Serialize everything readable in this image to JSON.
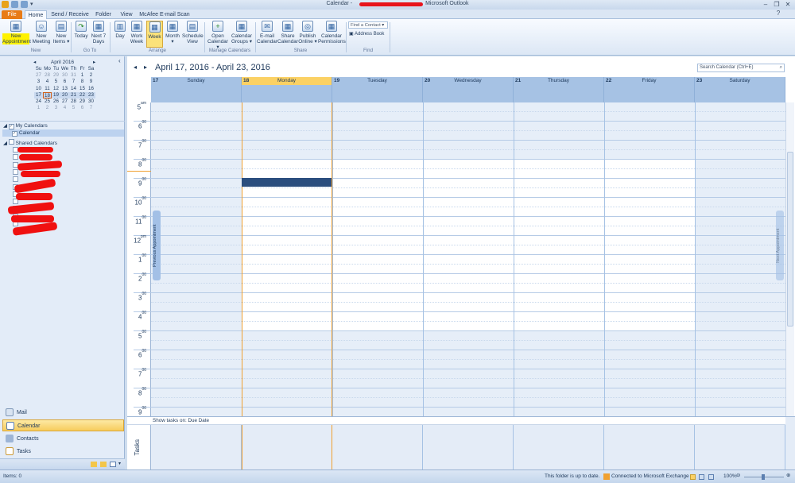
{
  "window": {
    "title_left": "Calendar - ",
    "title_right": "Microsoft Outlook"
  },
  "tabs": [
    "File",
    "Home",
    "Send / Receive",
    "Folder",
    "View",
    "McAfee E-mail Scan"
  ],
  "ribbon": {
    "buttons": [
      {
        "label1": "New",
        "label2": "Appointment"
      },
      {
        "label1": "New",
        "label2": "Meeting"
      },
      {
        "label1": "New",
        "label2": "Items ▾"
      },
      {
        "label1": "Today",
        "label2": ""
      },
      {
        "label1": "Next 7",
        "label2": "Days"
      },
      {
        "label1": "Day",
        "label2": ""
      },
      {
        "label1": "Work",
        "label2": "Week"
      },
      {
        "label1": "Week",
        "label2": ""
      },
      {
        "label1": "Month ▾",
        "label2": ""
      },
      {
        "label1": "Schedule",
        "label2": "View"
      },
      {
        "label1": "Open",
        "label2": "Calendar ▾"
      },
      {
        "label1": "Calendar",
        "label2": "Groups ▾"
      },
      {
        "label1": "E-mail",
        "label2": "Calendar"
      },
      {
        "label1": "Share",
        "label2": "Calendar"
      },
      {
        "label1": "Publish",
        "label2": "Online ▾"
      },
      {
        "label1": "Calendar",
        "label2": "Permissions"
      }
    ],
    "groups": [
      "New",
      "Go To",
      "Arrange",
      "Manage Calendars",
      "Share",
      "Find"
    ],
    "find_contact_placeholder": "Find a Contact ▾",
    "address_book": "Address Book"
  },
  "mini_calendar": {
    "month": "April 2016",
    "weekdays": [
      "Su",
      "Mo",
      "Tu",
      "We",
      "Th",
      "Fr",
      "Sa"
    ],
    "weeks": [
      [
        "27",
        "28",
        "29",
        "30",
        "31",
        "1",
        "2"
      ],
      [
        "3",
        "4",
        "5",
        "6",
        "7",
        "8",
        "9"
      ],
      [
        "10",
        "11",
        "12",
        "13",
        "14",
        "15",
        "16"
      ],
      [
        "17",
        "18",
        "19",
        "20",
        "21",
        "22",
        "23"
      ],
      [
        "24",
        "25",
        "26",
        "27",
        "28",
        "29",
        "30"
      ],
      [
        "1",
        "2",
        "3",
        "4",
        "5",
        "6",
        "7"
      ]
    ]
  },
  "folders": {
    "my_calendars": "My Calendars",
    "calendar": "Calendar",
    "shared_calendars": "Shared Calendars"
  },
  "nav": [
    "Mail",
    "Calendar",
    "Contacts",
    "Tasks"
  ],
  "calendar": {
    "range_title": "April 17, 2016 - April 23, 2016",
    "search_placeholder": "Search Calendar (Ctrl+E)",
    "days": [
      {
        "num": "17",
        "name": "Sunday"
      },
      {
        "num": "18",
        "name": "Monday"
      },
      {
        "num": "19",
        "name": "Tuesday"
      },
      {
        "num": "20",
        "name": "Wednesday"
      },
      {
        "num": "21",
        "name": "Thursday"
      },
      {
        "num": "22",
        "name": "Friday"
      },
      {
        "num": "23",
        "name": "Saturday"
      }
    ],
    "hours": [
      {
        "h": "5",
        "s": "am"
      },
      {
        "h": "6",
        "s": "00"
      },
      {
        "h": "7",
        "s": "00"
      },
      {
        "h": "8",
        "s": "00"
      },
      {
        "h": "9",
        "s": "00"
      },
      {
        "h": "10",
        "s": "00"
      },
      {
        "h": "11",
        "s": "00"
      },
      {
        "h": "12",
        "s": "pm"
      },
      {
        "h": "1",
        "s": "00"
      },
      {
        "h": "2",
        "s": "00"
      },
      {
        "h": "3",
        "s": "00"
      },
      {
        "h": "4",
        "s": "00"
      },
      {
        "h": "5",
        "s": "00"
      },
      {
        "h": "6",
        "s": "00"
      },
      {
        "h": "7",
        "s": "00"
      },
      {
        "h": "8",
        "s": "00"
      },
      {
        "h": "9",
        "s": "00"
      }
    ],
    "prev_appointment": "Previous Appointment",
    "next_appointment": "Next Appointment",
    "tasks_label": "Tasks",
    "show_tasks": "Show tasks on: Due Date"
  },
  "status": {
    "items": "Items: 0",
    "uptodate": "This folder is up to date.",
    "exchange": "Connected to Microsoft Exchange",
    "zoom": "100%"
  },
  "colors": {
    "accent": "#fbd164",
    "header": "#a6c2e4",
    "file_tab": "#e87b16"
  }
}
